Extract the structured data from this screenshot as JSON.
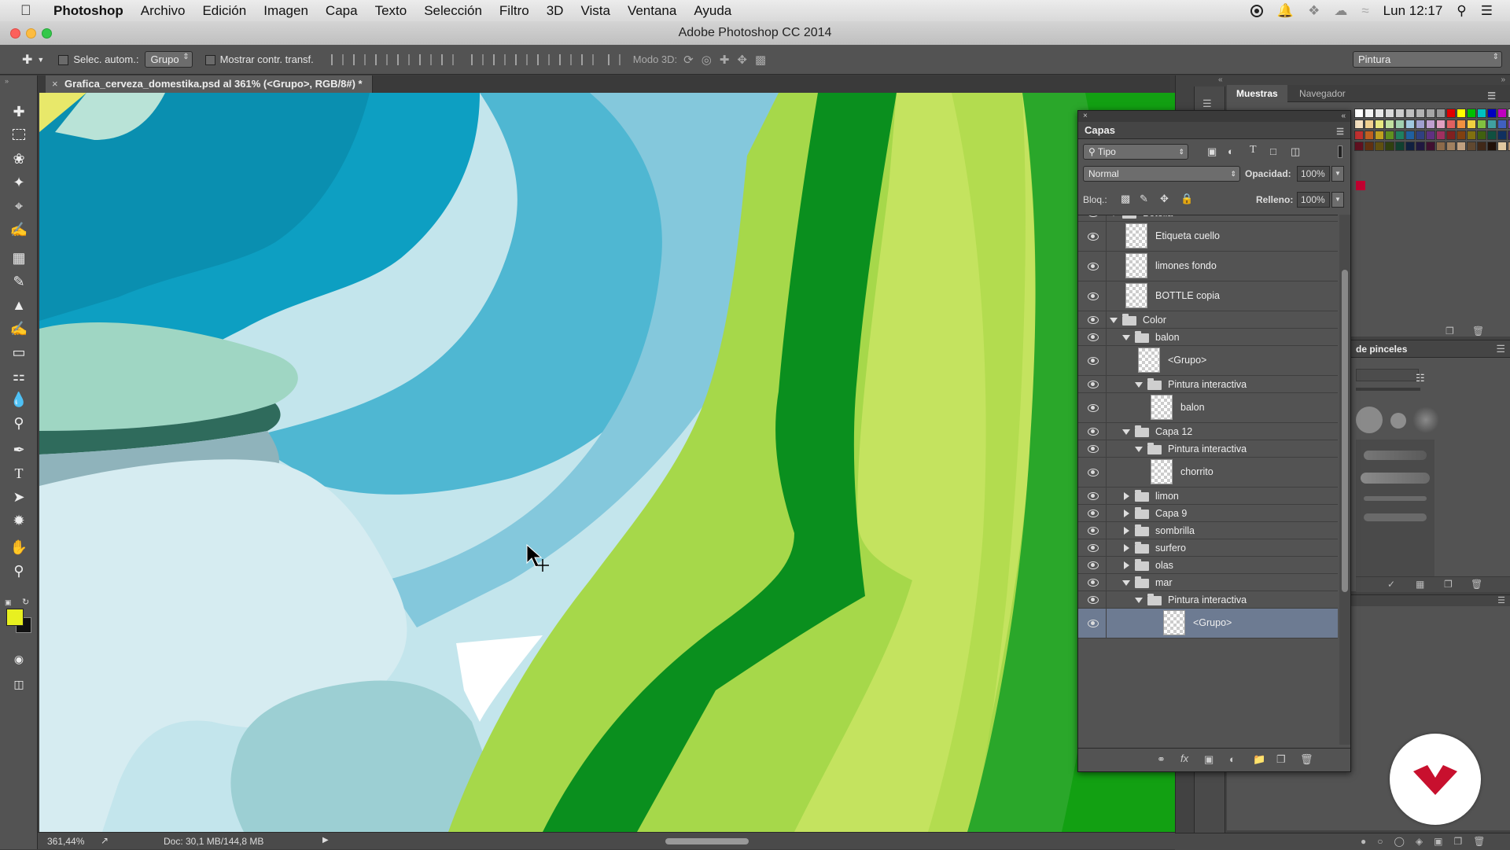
{
  "menubar": {
    "app": "Photoshop",
    "items": [
      "Archivo",
      "Edición",
      "Imagen",
      "Capa",
      "Texto",
      "Selección",
      "Filtro",
      "3D",
      "Vista",
      "Ventana",
      "Ayuda"
    ],
    "clock": "Lun 12:17"
  },
  "window": {
    "title": "Adobe Photoshop CC 2014"
  },
  "options": {
    "auto_select_label": "Selec. autom.:",
    "auto_select_value": "Grupo",
    "show_transform_label": "Mostrar contr. transf.",
    "mode3d_label": "Modo 3D:",
    "workspace": "Pintura"
  },
  "document": {
    "tab_title": "Grafica_cerveza_domestika.psd al 361% (<Grupo>, RGB/8#) *",
    "zoom": "361,44%",
    "doc_info": "Doc: 30,1 MB/144,8 MB"
  },
  "swatches": {
    "tabs": [
      "Muestras",
      "Navegador"
    ],
    "colors": [
      "#ffffff",
      "#f2f2f2",
      "#e6e6e6",
      "#d9d9d9",
      "#cccccc",
      "#bfbfbf",
      "#b3b3b3",
      "#a6a6a6",
      "#999999",
      "#e00000",
      "#ffff00",
      "#00c000",
      "#00c0c0",
      "#0000c0",
      "#c000c0",
      "#c8c8c8",
      "#f5e0c0",
      "#f0d090",
      "#e8e880",
      "#c0e0a0",
      "#a0d0b0",
      "#a0c8e0",
      "#a0a0d0",
      "#c0a0d0",
      "#e0a0c0",
      "#e06060",
      "#f09040",
      "#f0d040",
      "#80c040",
      "#40a0a0",
      "#4060c0",
      "#8040a0",
      "#c03030",
      "#c06020",
      "#c0a020",
      "#609020",
      "#208060",
      "#2060a0",
      "#304080",
      "#603080",
      "#a03060",
      "#802020",
      "#804010",
      "#807010",
      "#406010",
      "#105040",
      "#103060",
      "#402060",
      "#601020",
      "#603010",
      "#605010",
      "#304010",
      "#104030",
      "#102040",
      "#201840",
      "#401030",
      "#8c6a4a",
      "#a08060",
      "#c0a080",
      "#604830",
      "#402818",
      "#201008",
      "#e0c8a0",
      "#b09070"
    ],
    "selected_red": "#c00030"
  },
  "brushes_panel": {
    "title": "de pinceles"
  },
  "layers": {
    "title": "Capas",
    "filter_kind": "Tipo",
    "blend_mode": "Normal",
    "opacity_label": "Opacidad:",
    "opacity": "100%",
    "lock_label": "Bloq.:",
    "fill_label": "Relleno:",
    "fill": "100%",
    "rows": [
      {
        "name": "Botella",
        "kind": "group",
        "indent": 0,
        "open": true
      },
      {
        "name": "Etiqueta cuello",
        "kind": "layer",
        "indent": 0
      },
      {
        "name": "limones fondo",
        "kind": "layer",
        "indent": 0
      },
      {
        "name": "BOTTLE copia",
        "kind": "layer",
        "indent": 0
      },
      {
        "name": "Color",
        "kind": "group",
        "indent": 0,
        "open": true
      },
      {
        "name": "balon",
        "kind": "group",
        "indent": 1,
        "open": true
      },
      {
        "name": "<Grupo>",
        "kind": "layer",
        "indent": 1
      },
      {
        "name": "Pintura interactiva",
        "kind": "group",
        "indent": 2,
        "open": true
      },
      {
        "name": "balon",
        "kind": "layer",
        "indent": 2
      },
      {
        "name": "Capa 12",
        "kind": "group",
        "indent": 1,
        "open": true
      },
      {
        "name": "Pintura interactiva",
        "kind": "group",
        "indent": 2,
        "open": true
      },
      {
        "name": "chorrito",
        "kind": "layer",
        "indent": 2
      },
      {
        "name": "limon",
        "kind": "group",
        "indent": 1,
        "open": false
      },
      {
        "name": "Capa 9",
        "kind": "group",
        "indent": 1,
        "open": false
      },
      {
        "name": "sombrilla",
        "kind": "group",
        "indent": 1,
        "open": false
      },
      {
        "name": "surfero",
        "kind": "group",
        "indent": 1,
        "open": false
      },
      {
        "name": "olas",
        "kind": "group",
        "indent": 1,
        "open": false
      },
      {
        "name": "mar",
        "kind": "group",
        "indent": 1,
        "open": true
      },
      {
        "name": "Pintura interactiva",
        "kind": "group",
        "indent": 2,
        "open": true
      },
      {
        "name": "<Grupo>",
        "kind": "layer",
        "indent": 3,
        "selected": true
      }
    ]
  },
  "colors": {
    "foreground": "#e8f020",
    "background": "#111111",
    "selection": "#6d7b92",
    "brand_logo": "#c8102e"
  }
}
